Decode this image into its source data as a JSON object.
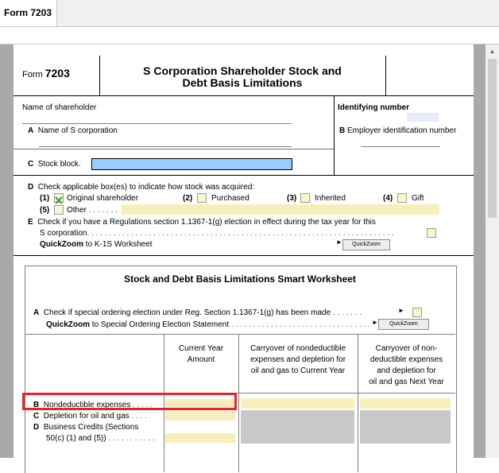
{
  "tab": {
    "label": "Form 7203"
  },
  "form": {
    "form_word": "Form",
    "form_number": "7203",
    "title_line1": "S Corporation Shareholder Stock and",
    "title_line2": "Debt Basis Limitations",
    "name_of_shareholder": "Name of shareholder",
    "identifying_number": "Identifying number",
    "line_a_letter": "A",
    "line_a_text": "Name of S corporation",
    "line_b_letter": "B",
    "line_b_text": "Employer identification number",
    "line_c_letter": "C",
    "line_c_text": "Stock block.",
    "line_d_letter": "D",
    "line_d_text": "Check applicable box(es) to indicate how stock was acquired:",
    "d1_num": "(1)",
    "d1_label": "Original shareholder",
    "d1_checked": true,
    "d2_num": "(2)",
    "d2_label": "Purchased",
    "d3_num": "(3)",
    "d3_label": "Inherited",
    "d4_num": "(4)",
    "d4_label": "Gift",
    "d5_num": "(5)",
    "d5_label": "Other",
    "line_e_letter": "E",
    "line_e_text1": "Check if you have a Regulations section 1.1367-1(g) election in effect during the tax year for this",
    "line_e_text2": "S corporation",
    "quickzoom_bold": "QuickZoom",
    "qz1_rest": "to K-1S Worksheet",
    "quickzoom_button": "QuickZoom"
  },
  "worksheet": {
    "title": "Stock and Debt Basis Limitations Smart Worksheet",
    "line_a_letter": "A",
    "line_a_text": "Check if special ordering election under Reg. Section 1.1367-1(g) has been made",
    "quickzoom_bold": "QuickZoom",
    "qz2_rest": "to Special Ordering Election Statement",
    "quickzoom_button": "QuickZoom",
    "col1_l1": "Current Year",
    "col1_l2": "Amount",
    "col2_l1": "Carryover of nondeductible",
    "col2_l2": "expenses and depletion for",
    "col2_l3": "oil and gas to Current Year",
    "col3_l1": "Carryover of non-",
    "col3_l2": "deductible expenses",
    "col3_l3": "and depletion for",
    "col3_l4": "oil and gas Next Year",
    "rows": [
      {
        "letter": "B",
        "label": "Nondeductible expenses"
      },
      {
        "letter": "C",
        "label": "Depletion for oil and gas"
      },
      {
        "letter": "D",
        "label": "Business Credits (Sections",
        "label2": "50(c) (1) and (5))"
      }
    ]
  },
  "colors": {
    "input_yellow": "#f7efbb",
    "stock_block_blue": "#99ccff",
    "highlight_red": "#e8242a",
    "check_green": "#2aa34a"
  }
}
